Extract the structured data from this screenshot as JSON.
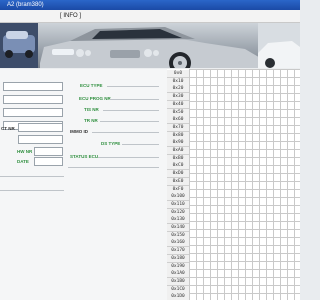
{
  "window": {
    "title": "A2 (bram380)"
  },
  "menu": {
    "info_label": "[ INFO ]"
  },
  "form": {
    "labels": {
      "ecu_type": "ECU TYPE",
      "ecu_prog_nr": "ECU PROG NR",
      "tis_nr": "TIS NR",
      "tr_nr": "TR NR",
      "immo_id": "IMMO ID",
      "ds_type": "DS TYPE",
      "status_ecu": "STATUS ECU",
      "ct_nr": "CT NR",
      "hw_nr": "HW NR",
      "date": "DATE"
    }
  },
  "grid": {
    "addresses": [
      "0x0",
      "0x10",
      "0x20",
      "0x30",
      "0x40",
      "0x50",
      "0x60",
      "0x70",
      "0x80",
      "0x90",
      "0xA0",
      "0xB0",
      "0xC0",
      "0xD0",
      "0xE0",
      "0xF0",
      "0x100",
      "0x110",
      "0x120",
      "0x130",
      "0x140",
      "0x150",
      "0x160",
      "0x170",
      "0x180",
      "0x190",
      "0x1A0",
      "0x1B0",
      "0x1C0",
      "0x1D0"
    ]
  }
}
